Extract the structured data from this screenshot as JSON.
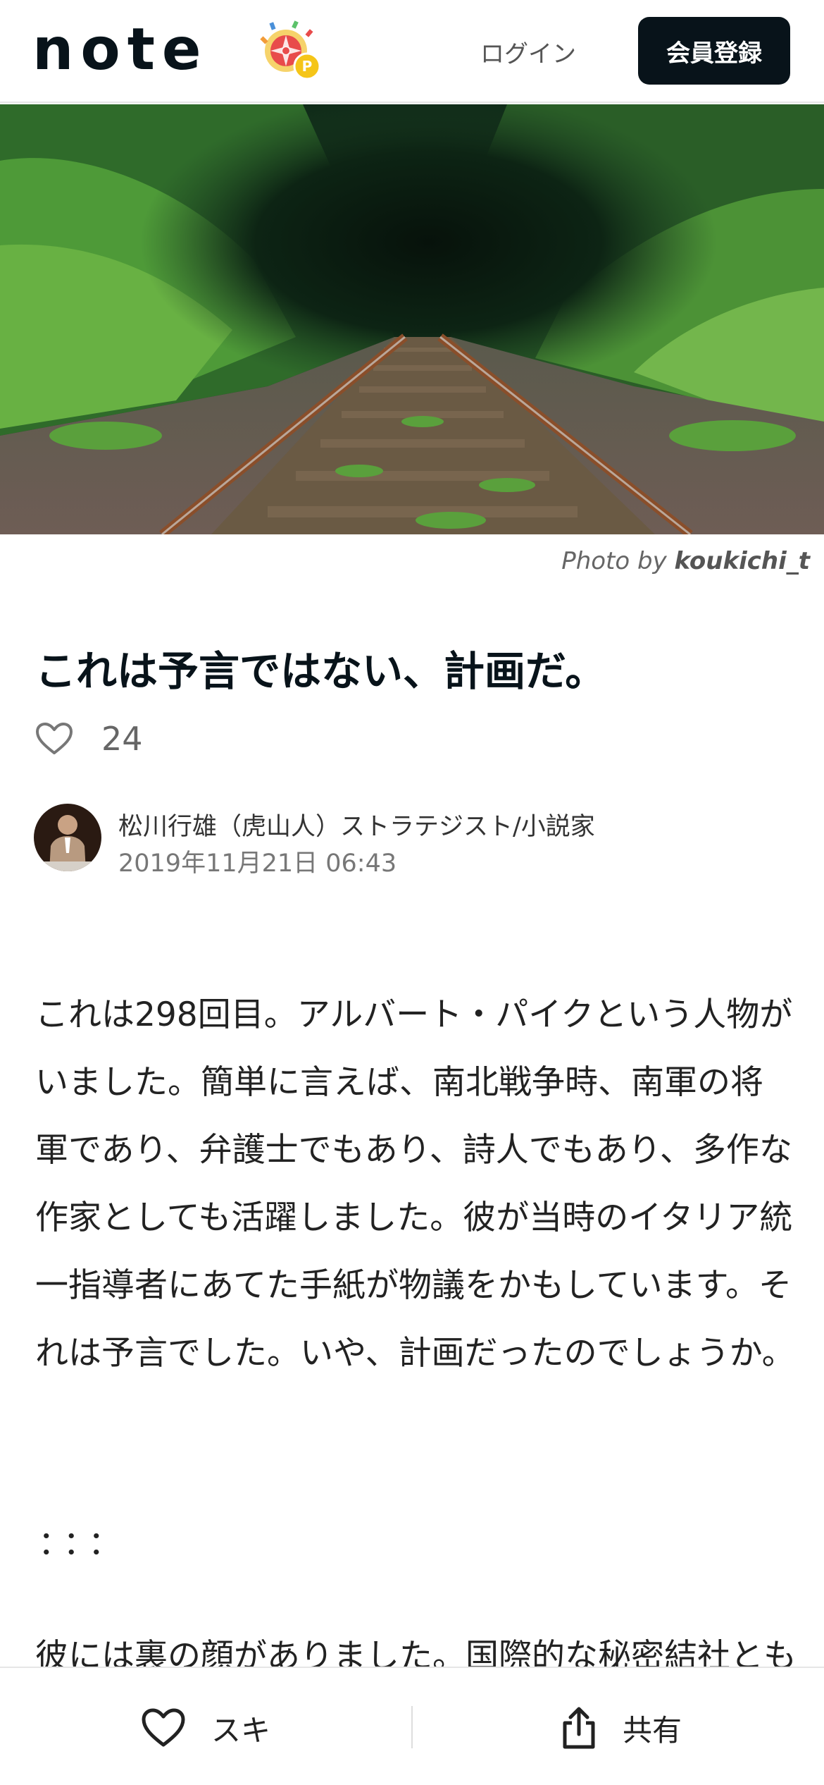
{
  "header": {
    "logo": "note",
    "login_label": "ログイン",
    "signup_label": "会員登録"
  },
  "hero": {
    "credit_prefix": "Photo by",
    "credit_author": "koukichi_t"
  },
  "article": {
    "title": "これは予言ではない、計画だ。",
    "like_count": "24",
    "author_name": "松川行雄（虎山人）ストラテジスト/小説家",
    "date": "2019年11月21日 06:43",
    "body": "これは298回目。アルバート・パイクという人物がいました。簡単に言えば、南北戦争時、南軍の将軍であり、弁護士でもあり、詩人でもあり、多作な作家としても活躍しました。彼が当時のイタリア統一指導者にあてた手紙が物議をかもしています。それは予言でした。いや、計画だったのでしょうか。",
    "separator": "：：：",
    "partial_line": "彼には裏の顔がありました。国際的な秘密結社とも"
  },
  "bottom_bar": {
    "like_label": "スキ",
    "share_label": "共有"
  },
  "colors": {
    "brand_dark": "#08131a",
    "text_gray": "#666666"
  }
}
